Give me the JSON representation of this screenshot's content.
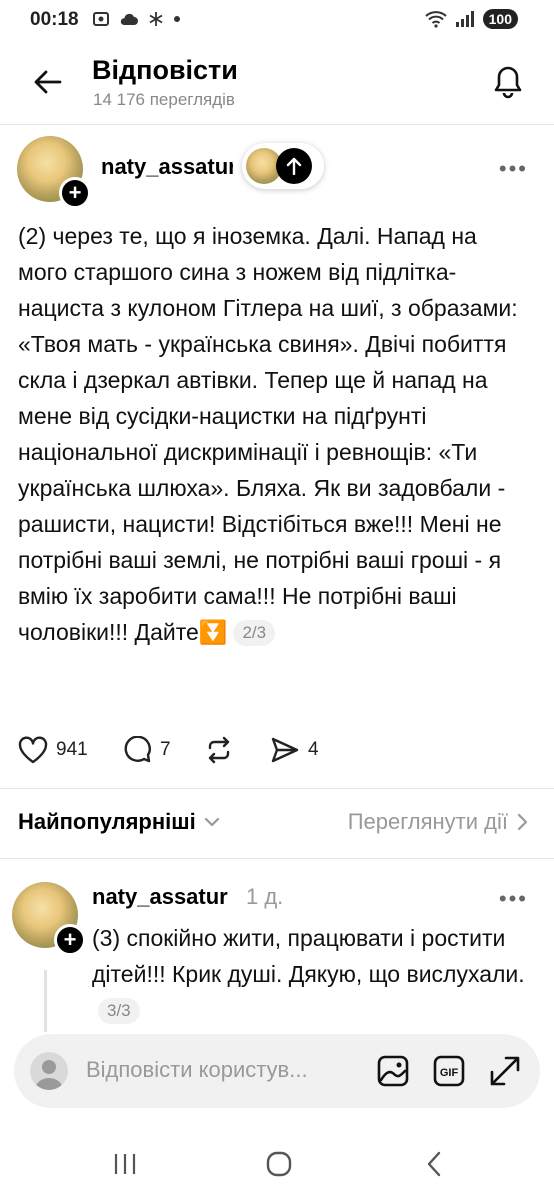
{
  "status_bar": {
    "time": "00:18",
    "battery": "100"
  },
  "header": {
    "title": "Відповісти",
    "views": "14 176 переглядів"
  },
  "post": {
    "username": "naty_assatur",
    "text": "(2) через те, що я іноземка. Далі. Напад на мого старшого сина з ножем від підлітка-нациста з кулоном Гітлера на шиї, з образами: «Твоя мать - українська свиня». Двічі побиття скла і дзеркал автівки. Тепер ще й напад на мене від сусідки-нацистки на підґрунті національної дискримінації і ревнощів: «Ти українська шлюха». Бляха. Як ви задовбали - рашисти, нацисти! Відстібіться вже!!! Мені не потрібні ваші землі, не потрібні ваші гроші - я вмію їх заробити сама!!! Не потрібні ваші чоловіки!!! Дайте",
    "emoji": "⏬",
    "counter": "2/3",
    "likes": "941",
    "comments": "7",
    "shares": "4"
  },
  "sort": {
    "label": "Найпопулярніші",
    "view_activity": "Переглянути дії"
  },
  "reply_post": {
    "username": "naty_assatur",
    "time": "1 д.",
    "text": "(3) спокійно жити, працювати і ростити дітей!!! Крик душі. Дякую, що вислухали.",
    "counter": "3/3"
  },
  "reply_bar": {
    "placeholder": "Відповісти користув..."
  },
  "icons": {
    "back": "arrow-left-icon",
    "bell": "bell-icon",
    "more": "more-dots-icon",
    "like": "heart-icon",
    "comment": "comment-icon",
    "repost": "repost-icon",
    "share": "send-icon",
    "image": "image-icon",
    "gif": "gif-icon",
    "expand": "expand-icon",
    "nav_recent": "recent-apps-icon",
    "nav_home": "home-icon",
    "nav_back": "back-icon"
  }
}
